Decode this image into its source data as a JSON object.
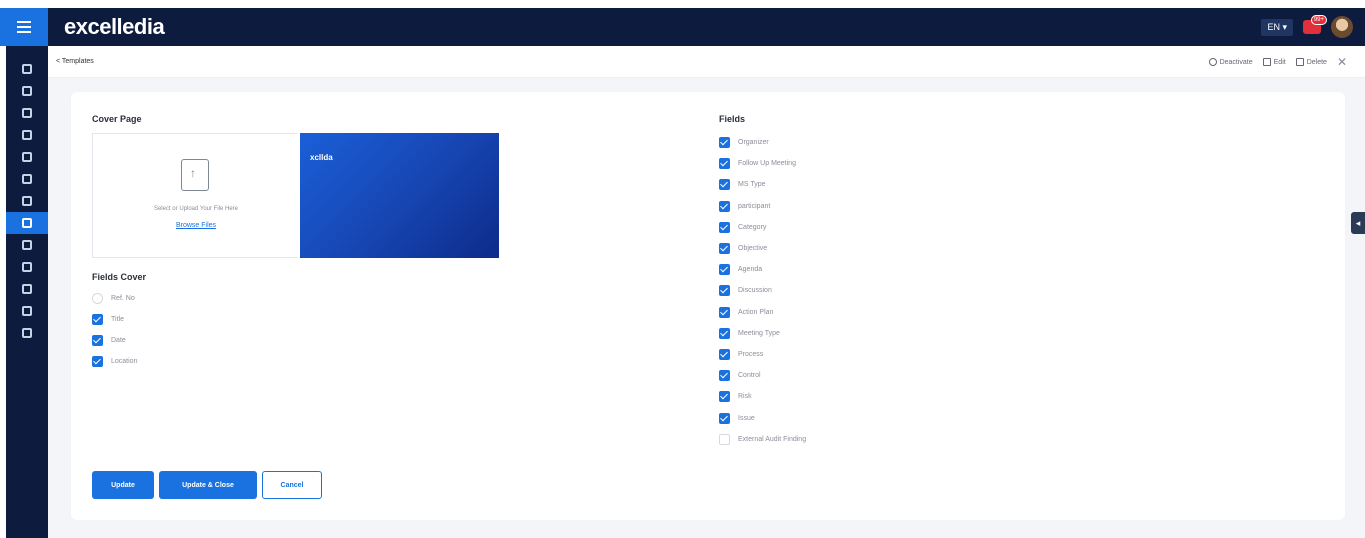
{
  "app": {
    "brand": "excelledia",
    "language": "EN",
    "notification_count": "99+"
  },
  "breadcrumb": "< Templates",
  "actions": {
    "deactivate": "Deactivate",
    "edit": "Edit",
    "delete": "Delete"
  },
  "cover_page": {
    "title": "Cover Page",
    "upload_text": "Select or Upload Your File Here",
    "browse_label": "Browse Files",
    "preview_logo": "xcllda"
  },
  "fields_cover": {
    "title": "Fields Cover",
    "items": [
      {
        "label": "Ref. No",
        "checked": false
      },
      {
        "label": "Title",
        "checked": true
      },
      {
        "label": "Date",
        "checked": true
      },
      {
        "label": "Location",
        "checked": true
      }
    ]
  },
  "fields": {
    "title": "Fields",
    "items": [
      {
        "label": "Organizer",
        "checked": true
      },
      {
        "label": "Follow Up Meeting",
        "checked": true
      },
      {
        "label": "MS Type",
        "checked": true
      },
      {
        "label": "participant",
        "checked": true
      },
      {
        "label": "Category",
        "checked": true
      },
      {
        "label": "Objective",
        "checked": true
      },
      {
        "label": "Agenda",
        "checked": true
      },
      {
        "label": "Discussion",
        "checked": true
      },
      {
        "label": "Action Plan",
        "checked": true
      },
      {
        "label": "Meeting Type",
        "checked": true
      },
      {
        "label": "Process",
        "checked": true
      },
      {
        "label": "Control",
        "checked": true
      },
      {
        "label": "Risk",
        "checked": true
      },
      {
        "label": "Issue",
        "checked": true
      },
      {
        "label": "External Audit Finding",
        "checked": false
      }
    ]
  },
  "buttons": {
    "update": "Update",
    "update_close": "Update & Close",
    "cancel": "Cancel"
  },
  "colors": {
    "brand_blue": "#1a72e0",
    "navy": "#0d1b3f"
  },
  "sidebar": {
    "items": [
      "home-icon",
      "document-icon",
      "people-icon",
      "warning-icon",
      "calendar-icon",
      "clipboard-icon",
      "shield-icon",
      "meetings-icon",
      "file-icon",
      "user-icon",
      "lock-icon",
      "list-icon",
      "settings-icon"
    ],
    "active_index": 7
  }
}
